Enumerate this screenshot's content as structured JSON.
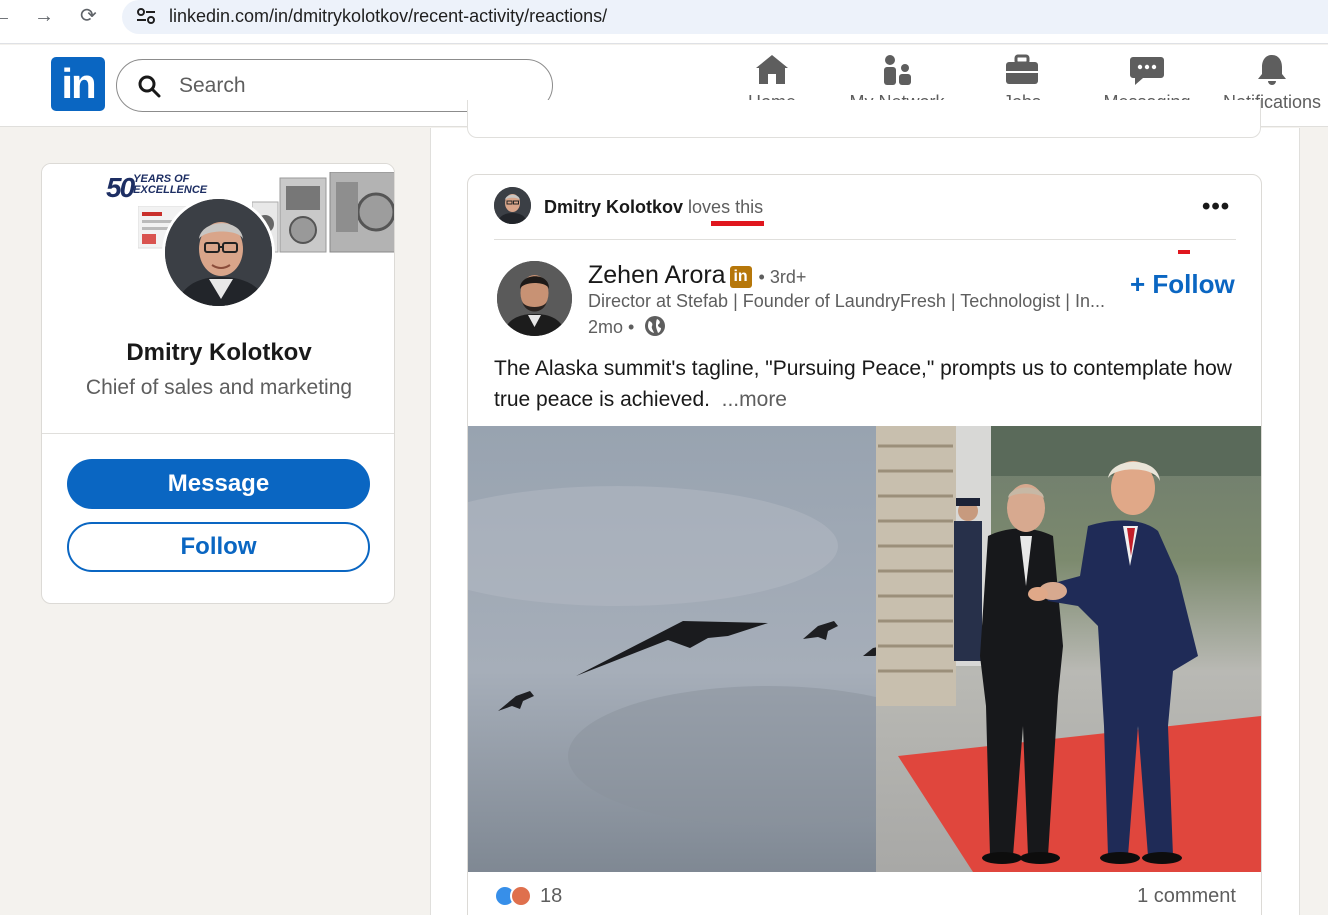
{
  "browser": {
    "url": "linkedin.com/in/dmitrykolotkov/recent-activity/reactions/"
  },
  "header": {
    "logo": "in",
    "search_placeholder": "Search",
    "nav": {
      "home": "Home",
      "network": "My Network",
      "jobs": "Jobs",
      "messaging": "Messaging",
      "notifications": "Notifications"
    }
  },
  "profile": {
    "banner_badge_big": "50",
    "banner_badge_small_1": "YEARS OF",
    "banner_badge_small_2": "EXCELLENCE",
    "name": "Dmitry Kolotkov",
    "headline": "Chief of sales and marketing",
    "message_label": "Message",
    "follow_label": "Follow"
  },
  "post": {
    "actor_name": "Dmitry Kolotkov",
    "actor_verb": "loves",
    "actor_suffix": "this",
    "more_icon": "•••",
    "author_name": "Zehen Arora",
    "author_badge": "in",
    "author_degree": "• 3rd+",
    "author_headline": "Director at Stefab | Founder of LaundryFresh | Technologist | In...",
    "author_time": "2mo •",
    "follow_label": "+ Follow",
    "text": "The Alaska summit's tagline, \"Pursuing Peace,\" prompts us to contemplate how true peace is achieved.",
    "see_more": "...more",
    "reaction_count": "18",
    "comment_count": "1 comment"
  },
  "colors": {
    "brand": "#0a66c2",
    "highlight": "#e0161e",
    "premium_badge": "#b6770a"
  }
}
